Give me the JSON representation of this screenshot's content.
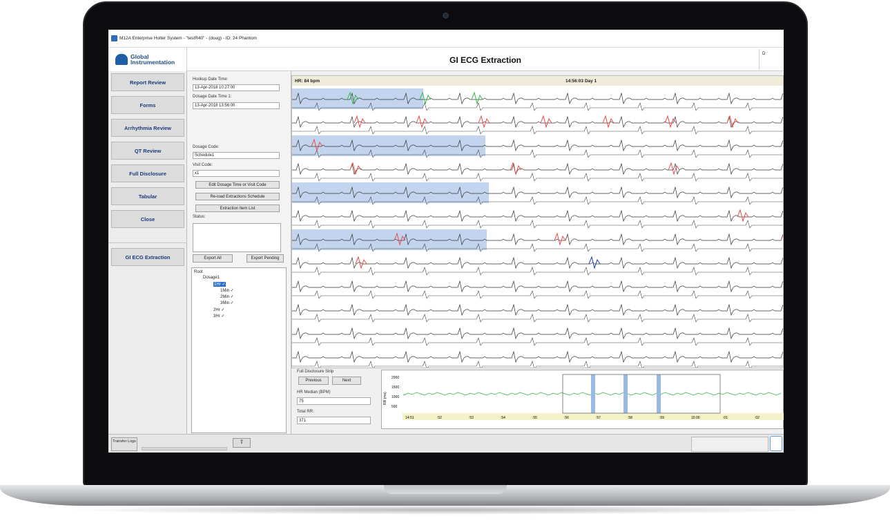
{
  "window": {
    "title": "M12A Enterprise Holter System - \"testR40\" - (doug) - ID: 24 Phantom"
  },
  "logo": {
    "line1": "Global",
    "line2": "Instrumentation"
  },
  "header": {
    "title": "GI ECG Extraction",
    "right_text": "D"
  },
  "nav": {
    "items": [
      "Report Review",
      "Forms",
      "Arrhythmia Review",
      "QT Review",
      "Full Disclosure",
      "Tabular",
      "Close"
    ],
    "active": "GI ECG Extraction"
  },
  "panel": {
    "hookup_label": "Hookup Date Time:",
    "hookup_value": "13-Apr-2018 10:27:00",
    "dosage_time_label": "Dosage Date Time 1:",
    "dosage_time_value": "13-Apr-2018 13:56:00",
    "dosage_code_label": "Dosage Code:",
    "dosage_code_value": "Schedule1",
    "visit_code_label": "Visit Code:",
    "visit_code_value": "x1",
    "edit_button": "Edit Dosage Time or Visit Code",
    "reload_button": "Re-load Extractions Schedule",
    "extraction_button": "Extraction Item List",
    "status_label": "Status:",
    "export_all": "Export All",
    "export_pending": "Export Pending"
  },
  "tree": {
    "root": "Root",
    "dosage": "Dosage1",
    "selected": "1Hr ✓",
    "children": [
      "1Min ✓",
      "2Min ✓",
      "3Min ✓"
    ],
    "others": [
      "2Hr ✓",
      "3Hr ✓"
    ]
  },
  "ecg": {
    "hr": "HR: 84 bpm",
    "time": "14:56:03 Day 1"
  },
  "strip": {
    "label": "Full Disclosure Strip",
    "previous": "Previous",
    "next": "Next",
    "hr_median_label": "HR Median (BPM)",
    "hr_median_value": "75",
    "total_rr_label": "Total RR:",
    "total_rr_value": "371",
    "y_label": "RR (ms)",
    "y_ticks": [
      "2000",
      "1500",
      "1000",
      "500"
    ],
    "x_ticks": [
      "14:51",
      ":52",
      ":53",
      ":54",
      ":55",
      ":56",
      ":57",
      ":58",
      ":59",
      "15:00",
      ":01",
      ":02",
      ":03"
    ]
  },
  "footer": {
    "transfer_logs": "Transfer Logs"
  },
  "colors": {
    "accent": "#1f4f86",
    "highlight": "#9bb9e3",
    "ecg_red": "#e84a4a",
    "ecg_green": "#2fb84a",
    "ecg_blue": "#2233bb"
  }
}
